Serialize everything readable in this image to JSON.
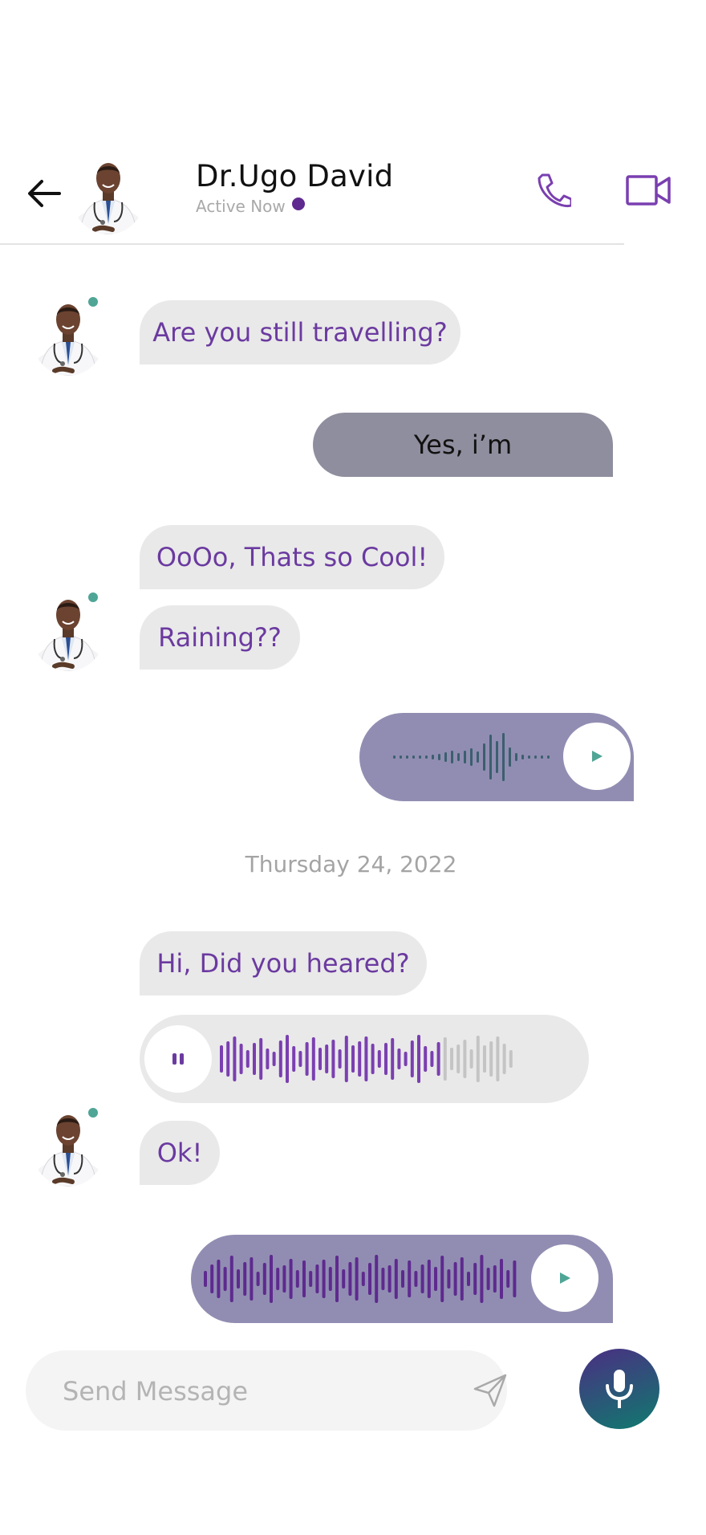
{
  "header": {
    "name": "Dr.Ugo David",
    "status": "Active Now",
    "status_color": "#5e2a8f"
  },
  "icons": {
    "back": "arrow-left-icon",
    "call": "phone-icon",
    "video": "video-camera-icon",
    "send": "send-icon",
    "mic": "microphone-icon",
    "play": "play-icon",
    "pause": "pause-icon"
  },
  "messages": {
    "m1": "Are you still travelling?",
    "m2": "Yes, i’m",
    "m3": "OoOo, Thats so Cool!",
    "m4": "Raining??",
    "m5": "Hi, Did you heared?",
    "m6": "Ok!"
  },
  "date_divider": "Thursday 24, 2022",
  "composer": {
    "placeholder": "Send Message",
    "value": ""
  },
  "voice_in_progress": 0.76,
  "colors": {
    "accent_purple": "#6b3aa0",
    "incoming_bubble": "#e9e9e9",
    "outgoing_bubble": "#8f8e9e",
    "voice_outgoing": "#918db2",
    "online": "#4fa596",
    "mic_gradient_start": "#4b2e83",
    "mic_gradient_end": "#0f7a6e"
  }
}
